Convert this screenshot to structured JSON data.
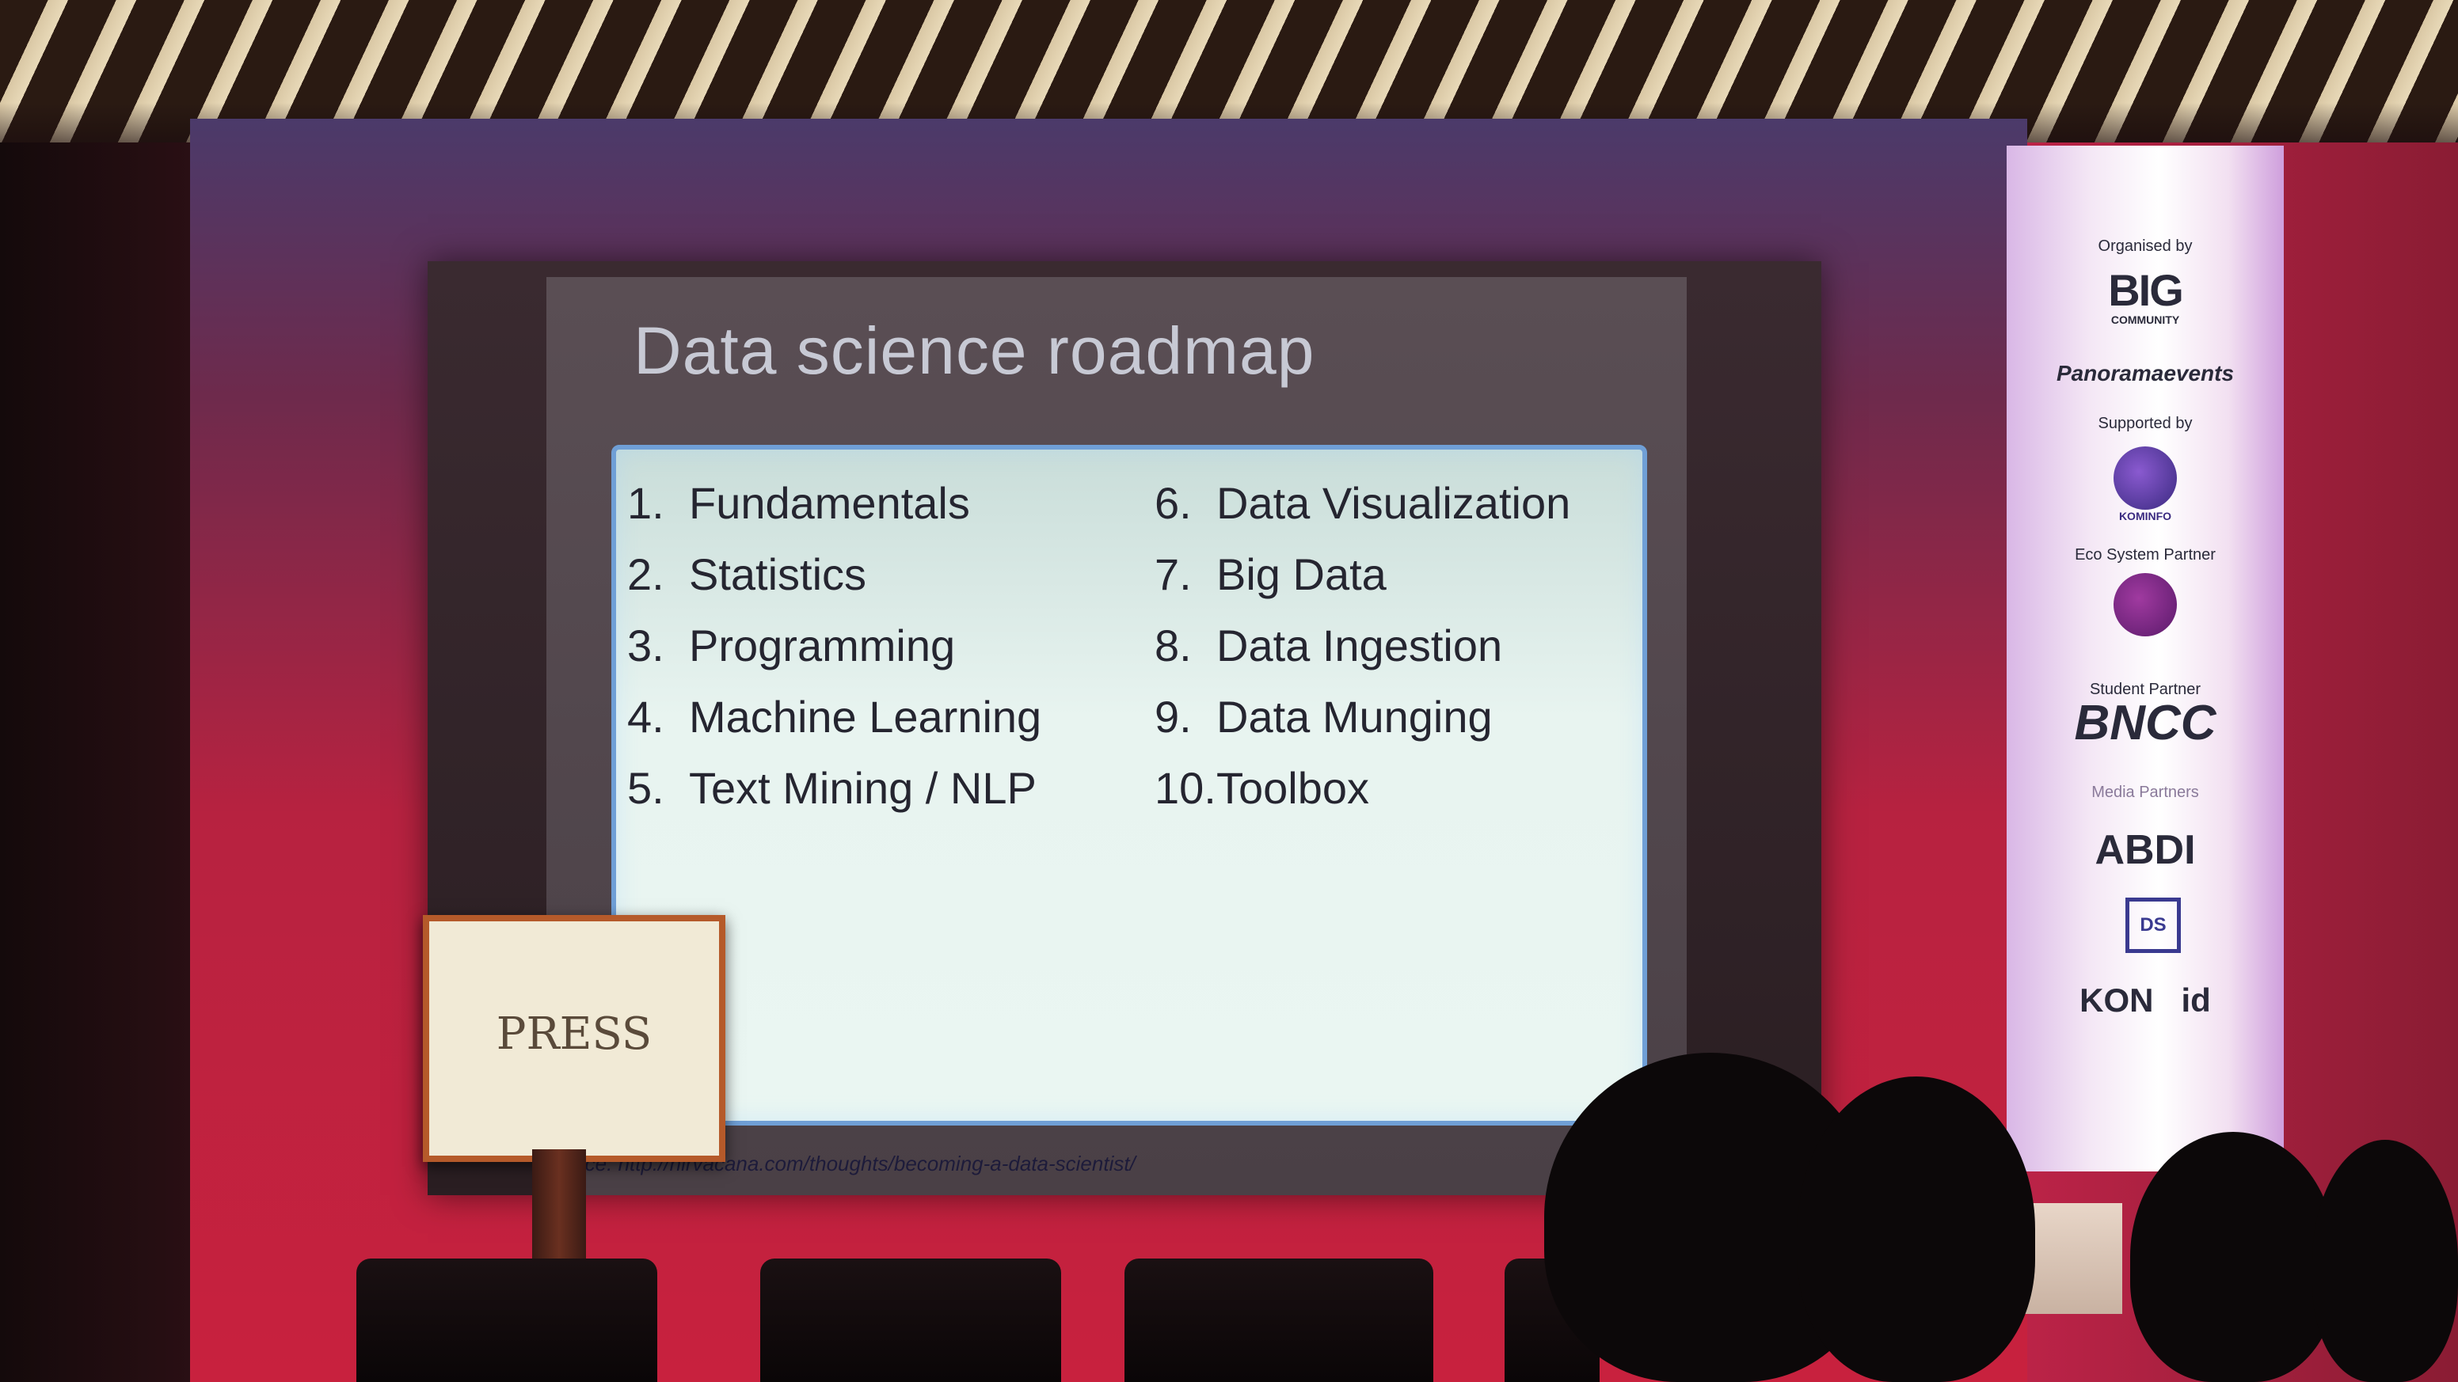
{
  "slide": {
    "title": "Data science roadmap",
    "left_items": [
      {
        "num": "1.",
        "label": "Fundamentals"
      },
      {
        "num": "2.",
        "label": "Statistics"
      },
      {
        "num": "3.",
        "label": "Programming"
      },
      {
        "num": "4.",
        "label": "Machine Learning"
      },
      {
        "num": "5.",
        "label": "Text Mining / NLP"
      }
    ],
    "right_items": [
      {
        "num": "6.",
        "label": "Data Visualization"
      },
      {
        "num": "7.",
        "label": "Big Data"
      },
      {
        "num": "8.",
        "label": "Data Ingestion"
      },
      {
        "num": "9.",
        "label": "Data Munging"
      },
      {
        "num": "10.",
        "label": "Toolbox"
      }
    ],
    "source": "rce: http://nirvacana.com/thoughts/becoming-a-data-scientist/"
  },
  "press_sign": "PRESS",
  "banner": {
    "organised_by": "Organised by",
    "big_logo": "BIG",
    "big_sub": "COMMUNITY",
    "panorama": "Panoramaevents",
    "supported_by": "Supported by",
    "kominfo": "KOMINFO",
    "eco_partner": "Eco System Partner",
    "student_partner": "Student Partner",
    "bncc": "BNCC",
    "media_partners": "Media Partners",
    "abdi": "ABDI",
    "ds": "DS",
    "kontan": "KON   id"
  },
  "colors": {
    "stage_red": "#c8213e",
    "slide_panel": "#e8f4f0",
    "panel_border": "#6f9fd6"
  }
}
